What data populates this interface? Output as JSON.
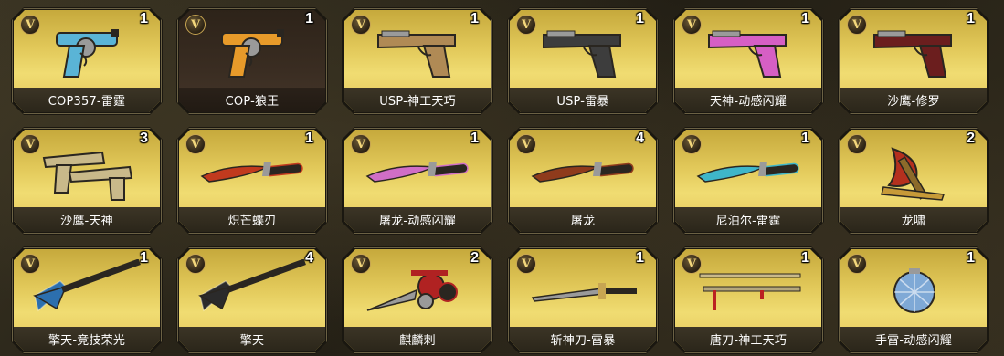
{
  "inventory": {
    "badge_letter": "V",
    "items": [
      {
        "name": "COP357-雷霆",
        "count": "1",
        "icon": "revolver-icon",
        "color": "#5ab4d6"
      },
      {
        "name": "COP-狼王",
        "count": "1",
        "icon": "revolver-icon",
        "color": "#e79a2a"
      },
      {
        "name": "USP-神工天巧",
        "count": "1",
        "icon": "pistol-icon",
        "color": "#b08a55"
      },
      {
        "name": "USP-雷暴",
        "count": "1",
        "icon": "pistol-icon",
        "color": "#3d3d3d"
      },
      {
        "name": "天神-动感闪耀",
        "count": "1",
        "icon": "pistol-icon",
        "color": "#d65fc4"
      },
      {
        "name": "沙鹰-修罗",
        "count": "1",
        "icon": "pistol-icon",
        "color": "#6b1e1e"
      },
      {
        "name": "沙鹰-天神",
        "count": "3",
        "icon": "dual-pistol-icon",
        "color": "#c9b98a"
      },
      {
        "name": "炽芒蝶刃",
        "count": "1",
        "icon": "knife-icon",
        "color": "#c13a1e"
      },
      {
        "name": "屠龙-动感闪耀",
        "count": "1",
        "icon": "knife-icon",
        "color": "#d06ec6"
      },
      {
        "name": "屠龙",
        "count": "4",
        "icon": "knife-icon",
        "color": "#8f3b1c"
      },
      {
        "name": "尼泊尔-雷霆",
        "count": "1",
        "icon": "knife-icon",
        "color": "#3fb6c9"
      },
      {
        "name": "龙啸",
        "count": "2",
        "icon": "axe-icon",
        "color": "#b5301e"
      },
      {
        "name": "擎天-竞技荣光",
        "count": "1",
        "icon": "spear-icon",
        "color": "#2c6fae"
      },
      {
        "name": "擎天",
        "count": "4",
        "icon": "spear-icon",
        "color": "#2b2b2b"
      },
      {
        "name": "麒麟刺",
        "count": "2",
        "icon": "knuckle-blade-icon",
        "color": "#b02222"
      },
      {
        "name": "斩神刀-雷暴",
        "count": "1",
        "icon": "sword-icon",
        "color": "#3b3b3b"
      },
      {
        "name": "唐刀-神工天巧",
        "count": "1",
        "icon": "katana-icon",
        "color": "#8a7a55"
      },
      {
        "name": "手雷-动感闪耀",
        "count": "1",
        "icon": "disco-grenade-icon",
        "color": "#7fa9d6"
      }
    ]
  }
}
